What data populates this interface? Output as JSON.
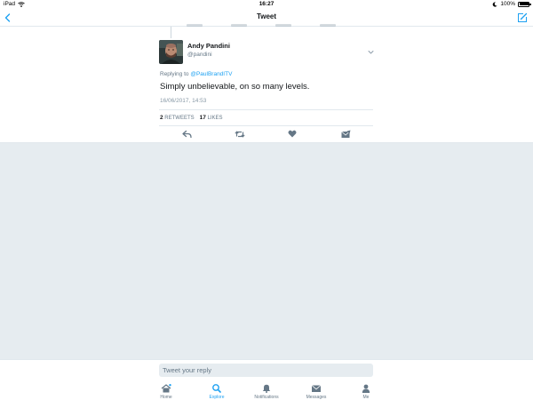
{
  "status_bar": {
    "device": "iPad",
    "time": "16:27",
    "battery": "100%",
    "battery_level": 1.0
  },
  "nav": {
    "title": "Tweet",
    "back_icon": "chevron-left-icon",
    "compose_icon": "compose-icon"
  },
  "tweet": {
    "author_name": "Andy Pandini",
    "author_handle": "@pandini",
    "replying_prefix": "Replying to",
    "reply_to_handle": "@PaulBrandITV",
    "text": "Simply unbelievable, on so many levels.",
    "date": "16/06/2017, 14:53",
    "retweets_count": "2",
    "retweets_label": "RETWEETS",
    "likes_count": "17",
    "likes_label": "LIKES",
    "actions": [
      "reply-icon",
      "retweet-icon",
      "heart-icon",
      "dm-icon"
    ]
  },
  "reply_box": {
    "placeholder": "Tweet your reply",
    "value": ""
  },
  "tabs": [
    {
      "label": "Home",
      "icon": "home-icon",
      "active": false,
      "has_dot": true
    },
    {
      "label": "Explore",
      "icon": "search-icon",
      "active": true
    },
    {
      "label": "Notifications",
      "icon": "bell-icon",
      "active": false
    },
    {
      "label": "Messages",
      "icon": "envelope-icon",
      "active": false
    },
    {
      "label": "Me",
      "icon": "person-icon",
      "active": false
    }
  ],
  "colors": {
    "accent": "#1da1f2",
    "text": "#14171a",
    "muted": "#657786",
    "background": "#e6ecf0",
    "icon": "#657786"
  }
}
